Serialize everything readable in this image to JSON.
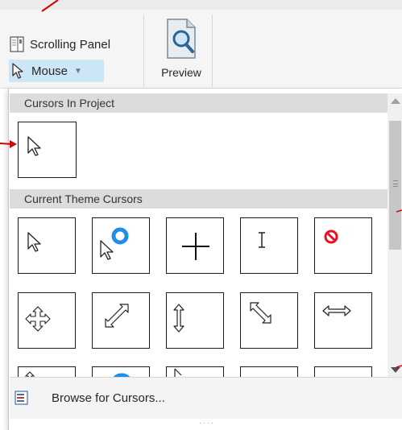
{
  "ribbon": {
    "scrolling_panel_label": "Scrolling Panel",
    "mouse_label": "Mouse",
    "preview_label": "Preview"
  },
  "gallery": {
    "project_header": "Cursors In Project",
    "theme_header": "Current Theme Cursors",
    "project_cursors": [
      {
        "icon": "arrow-cursor-icon"
      }
    ],
    "theme_cursors": [
      {
        "icon": "arrow-cursor-icon"
      },
      {
        "icon": "working-in-background-cursor-icon"
      },
      {
        "icon": "precision-select-crosshair-icon"
      },
      {
        "icon": "text-select-ibeam-icon"
      },
      {
        "icon": "unavailable-cursor-icon"
      },
      {
        "icon": "move-cursor-icon"
      },
      {
        "icon": "diagonal-resize-ne-sw-icon"
      },
      {
        "icon": "vertical-resize-icon"
      },
      {
        "icon": "diagonal-resize-nw-se-icon"
      },
      {
        "icon": "horizontal-resize-icon"
      }
    ],
    "browse_label": "Browse for Cursors...",
    "resize_grip": "····"
  },
  "colors": {
    "selected_bg": "#cde6f7",
    "header_bg": "#dcdcdc",
    "busy_ring": "#1e8fe8",
    "unavailable": "#e81123",
    "annotation": "#d40000"
  }
}
